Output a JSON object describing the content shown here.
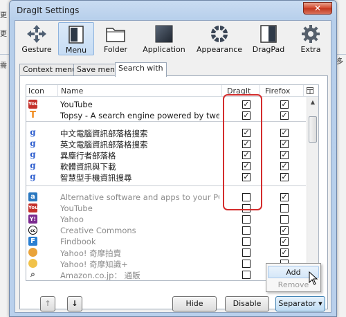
{
  "window": {
    "title": "DragIt Settings",
    "close_glyph": "✕"
  },
  "background": {
    "glyphs": [
      "更",
      "更",
      "需"
    ],
    "right_glyph": "多"
  },
  "toolbar": {
    "items": [
      {
        "label": "Gesture",
        "icon": "move-arrows-icon"
      },
      {
        "label": "Menu",
        "icon": "menu-window-icon",
        "active": true
      },
      {
        "label": "Folder",
        "icon": "folder-icon"
      },
      {
        "label": "Application",
        "icon": "application-icon"
      },
      {
        "label": "Appearance",
        "icon": "appearance-wheel-icon"
      },
      {
        "label": "DragPad",
        "icon": "dragpad-icon"
      },
      {
        "label": "Extra",
        "icon": "gear-icon"
      }
    ]
  },
  "tabs": [
    {
      "label": "Context menu"
    },
    {
      "label": "Save menu"
    },
    {
      "label": "Search with",
      "active": true
    }
  ],
  "list": {
    "columns": {
      "icon": "Icon",
      "name": "Name",
      "dragit": "DragIt",
      "firefox": "Firefox"
    },
    "check_glyph": "✓",
    "rows": [
      {
        "name": "YouTube",
        "icon": "youtube-icon",
        "dragit": true,
        "firefox": true,
        "dim": false
      },
      {
        "name": "Topsy - A search engine powered by tweets",
        "icon": "topsy-icon",
        "dragit": true,
        "firefox": true,
        "dim": false
      },
      {
        "name": "中文電腦資訊部落格搜索",
        "icon": "google-icon",
        "dragit": true,
        "firefox": true,
        "dim": false
      },
      {
        "name": "英文電腦資訊部落格搜索",
        "icon": "google-icon",
        "dragit": true,
        "firefox": true,
        "dim": false
      },
      {
        "name": "異塵行者部落格",
        "icon": "google-icon",
        "dragit": true,
        "firefox": true,
        "dim": false
      },
      {
        "name": "軟體資訊與下載",
        "icon": "google-icon",
        "dragit": true,
        "firefox": true,
        "dim": false
      },
      {
        "name": "智慧型手機資訊搜尋",
        "icon": "google-icon",
        "dragit": true,
        "firefox": true,
        "dim": false
      },
      {
        "name": "Alternative software and apps to your PC (...",
        "icon": "alternativeto-icon",
        "dragit": false,
        "firefox": true,
        "dim": true
      },
      {
        "name": "YouTube",
        "icon": "youtube-icon",
        "dragit": false,
        "firefox": false,
        "dim": true
      },
      {
        "name": "Yahoo",
        "icon": "yahoo-icon",
        "dragit": false,
        "firefox": false,
        "dim": true
      },
      {
        "name": "Creative Commons",
        "icon": "creative-commons-icon",
        "dragit": false,
        "firefox": true,
        "dim": true
      },
      {
        "name": "Findbook",
        "icon": "findbook-icon",
        "dragit": false,
        "firefox": true,
        "dim": true
      },
      {
        "name": "Yahoo! 奇摩拍賣",
        "icon": "yahoo-auction-icon",
        "dragit": false,
        "firefox": true,
        "dim": true
      },
      {
        "name": "Yahoo! 奇摩知識+",
        "icon": "yahoo-answers-icon",
        "dragit": false,
        "firefox": false,
        "dim": true
      },
      {
        "name": "Amazon.co.jp： 通販",
        "icon": "magnifier-icon",
        "dragit": false,
        "firefox": false,
        "dim": true
      }
    ]
  },
  "buttons": {
    "move_up": "↑",
    "move_down": "↓",
    "hide": "Hide",
    "disable": "Disable",
    "separator": "Separator ▾"
  },
  "separator_menu": {
    "add": "Add",
    "remove": "Remove"
  },
  "colors": {
    "highlight_box": "#d32c2c",
    "window_frame": "#b9d0ec"
  }
}
